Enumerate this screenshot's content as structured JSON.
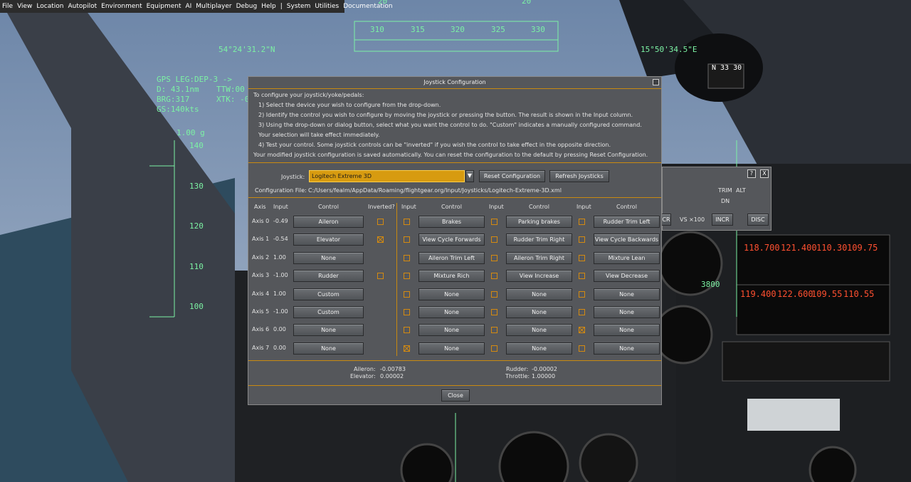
{
  "menu": [
    "File",
    "View",
    "Location",
    "Autopilot",
    "Environment",
    "Equipment",
    "AI",
    "Multiplayer",
    "Debug",
    "Help",
    "|",
    "System",
    "Utilities",
    "Documentation"
  ],
  "hud": {
    "heading_ticks": [
      "310",
      "315",
      "320",
      "325",
      "330"
    ],
    "heading_top": [
      "20",
      "20"
    ],
    "lat": "54°24'31.2\"N",
    "lon": "15°50'34.5\"E",
    "gps_leg": "GPS LEG:DEP-3   ->",
    "dist": "D: 43.1nm",
    "ttw": "TTW:00",
    "brg": "BRG:317",
    "xtk": "XTK: -0",
    "gs": "GS:140kts",
    "gload": "1.00 g",
    "speed_ticks": [
      "140",
      "130",
      "120",
      "110",
      "100"
    ],
    "alt_label": "3800",
    "compass": "N  33  30"
  },
  "dialog": {
    "title": "Joystick Configuration",
    "instructions": [
      "To configure your joystick/yoke/pedals:",
      "1) Select the device your wish to configure from the drop-down.",
      "2) Identify the control you wish to configure by moving the joystick or pressing the button.  The result is shown in the Input column.",
      "3) Using the drop-down or dialog button, select what you want the control to do.  \"Custom\" indicates a manually configured command.",
      "Your selection will take effect immediately.",
      "4) Test your control.  Some joystick controls can be \"inverted\" if you wish the control to take effect in the opposite direction.",
      "Your modified joystick configuration is saved automatically.  You can reset the configuration to the default by pressing Reset Configuration."
    ],
    "joystick_label": "Joystick:",
    "joystick_value": "Logitech Extreme 3D",
    "reset_button": "Reset Configuration",
    "refresh_button": "Refresh Joysticks",
    "config_file_label": "Configuration File:",
    "config_file_path": "C:/Users/fealm/AppData/Roaming/flightgear.org/Input/Joysticks/Logitech-Extreme-3D.xml",
    "headers": {
      "axis": "Axis",
      "input": "Input",
      "control": "Control",
      "inverted": "Inverted?"
    },
    "axes": [
      {
        "axis": "Axis 0",
        "input": "-0.49",
        "control": "Aileron",
        "inverted": false,
        "has_invert": true
      },
      {
        "axis": "Axis 1",
        "input": "-0.54",
        "control": "Elevator",
        "inverted": true,
        "has_invert": true
      },
      {
        "axis": "Axis 2",
        "input": "1.00",
        "control": "None",
        "inverted": false,
        "has_invert": false
      },
      {
        "axis": "Axis 3",
        "input": "-1.00",
        "control": "Rudder",
        "inverted": false,
        "has_invert": true
      },
      {
        "axis": "Axis 4",
        "input": "1.00",
        "control": "Custom",
        "inverted": false,
        "has_invert": false
      },
      {
        "axis": "Axis 5",
        "input": "-1.00",
        "control": "Custom",
        "inverted": false,
        "has_invert": false
      },
      {
        "axis": "Axis 6",
        "input": "0.00",
        "control": "None",
        "inverted": false,
        "has_invert": false
      },
      {
        "axis": "Axis 7",
        "input": "0.00",
        "control": "None",
        "inverted": false,
        "has_invert": false
      }
    ],
    "button_cols": [
      [
        {
          "checked": false,
          "control": "Brakes"
        },
        {
          "checked": false,
          "control": "View Cycle Forwards"
        },
        {
          "checked": false,
          "control": "Aileron Trim Left"
        },
        {
          "checked": false,
          "control": "Mixture Rich"
        },
        {
          "checked": false,
          "control": "None"
        },
        {
          "checked": false,
          "control": "None"
        },
        {
          "checked": false,
          "control": "None"
        },
        {
          "checked": true,
          "control": "None"
        }
      ],
      [
        {
          "checked": false,
          "control": "Parking brakes"
        },
        {
          "checked": false,
          "control": "Rudder Trim Right"
        },
        {
          "checked": false,
          "control": "Aileron Trim Right"
        },
        {
          "checked": false,
          "control": "View Increase"
        },
        {
          "checked": false,
          "control": "None"
        },
        {
          "checked": false,
          "control": "None"
        },
        {
          "checked": false,
          "control": "None"
        },
        {
          "checked": false,
          "control": "None"
        }
      ],
      [
        {
          "checked": false,
          "control": "Rudder Trim Left"
        },
        {
          "checked": false,
          "control": "View Cycle Backwards"
        },
        {
          "checked": false,
          "control": "Mixture Lean"
        },
        {
          "checked": false,
          "control": "View Decrease"
        },
        {
          "checked": false,
          "control": "None"
        },
        {
          "checked": false,
          "control": "None"
        },
        {
          "checked": true,
          "control": "None"
        },
        {
          "checked": false,
          "control": "None"
        }
      ]
    ],
    "status": {
      "aileron_label": "Aileron:",
      "aileron": "-0.00783",
      "elevator_label": "Elevator:",
      "elevator": "0.00002",
      "rudder_label": "Rudder:",
      "rudder": "-0.00002",
      "throttle_label": "Throttle:",
      "throttle": "1.00000"
    },
    "close_button": "Close"
  },
  "panel2": {
    "trim": "TRIM",
    "alt": "ALT",
    "dn": "DN",
    "cr": "CR",
    "vs": "VS ×100",
    "incr": "INCR",
    "disc": "DISC",
    "help": "?",
    "close": "X"
  },
  "radios": {
    "com1": "118.700",
    "com1_sb": "121.400",
    "nav1": "110.30",
    "nav1_sb": "109.75",
    "com2": "119.400",
    "com2_sb": "122.600",
    "nav2": "109.55",
    "nav2_sb": "110.55"
  },
  "colors": {
    "accent": "#d48a10",
    "hud": "#7cf2a4",
    "dialog_bg": "#55575b"
  }
}
